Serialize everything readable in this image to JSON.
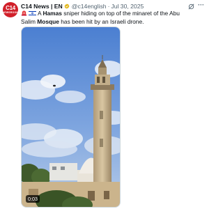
{
  "account": {
    "avatar_text_big": "C14",
    "avatar_text_small": "NEWSROOM",
    "name": "C14 News | EN",
    "handle": "@c14english",
    "separator": "·",
    "date": "Jul 30, 2025"
  },
  "tweet": {
    "prefix": "A ",
    "bold1": "Hamas",
    "middle": " sniper hiding on top of the minaret of the Abu Salim ",
    "bold2": "Mosque",
    "suffix": " has been hit by an Israeli drone."
  },
  "media": {
    "timestamp": "0:03"
  },
  "icons": {
    "emoji1": "siren-emoji",
    "emoji2": "israel-flag-emoji",
    "grok": "grok-icon",
    "more": "more-icon"
  },
  "colors": {
    "brand_red": "#d1202a",
    "verified_gold": "#e2b719",
    "text_secondary": "#536471"
  }
}
